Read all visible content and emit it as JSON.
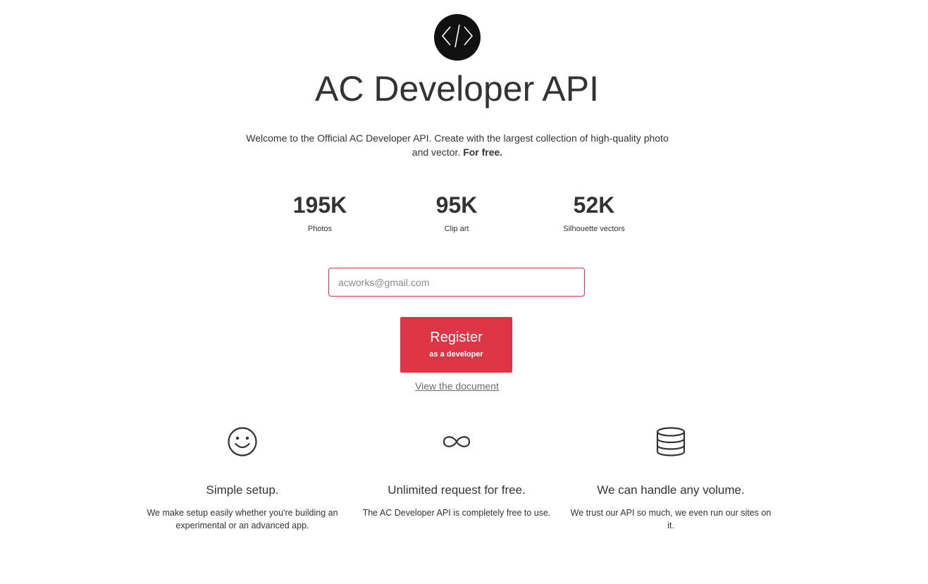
{
  "header": {
    "logo_icon": "code-brackets-icon",
    "title": "AC Developer API"
  },
  "intro": {
    "text": "Welcome to the Official AC Developer API. Create with the largest collection of high-quality photo and vector.",
    "emphasis": "For free."
  },
  "stats": [
    {
      "value": "195K",
      "label": "Photos"
    },
    {
      "value": "95K",
      "label": "Clip art"
    },
    {
      "value": "52K",
      "label": "Silhouette vectors"
    }
  ],
  "signup": {
    "email_placeholder": "acworks@gmail.com",
    "email_value": "",
    "register_label": "Register",
    "register_sublabel": "as a developer",
    "doc_link": "View the document"
  },
  "features": [
    {
      "icon": "smiley-icon",
      "title": "Simple setup.",
      "description": "We make setup easily whether you're building an experimental or an advanced app."
    },
    {
      "icon": "infinity-icon",
      "title": "Unlimited request for free.",
      "description": "The AC Developer API is completely free to use."
    },
    {
      "icon": "database-icon",
      "title": "We can handle any volume.",
      "description": "We trust our API so much, we even run our sites on it."
    }
  ],
  "colors": {
    "accent": "#dc3545",
    "text": "#333333",
    "logo_bg": "#111111",
    "link": "#6c6c6c"
  }
}
